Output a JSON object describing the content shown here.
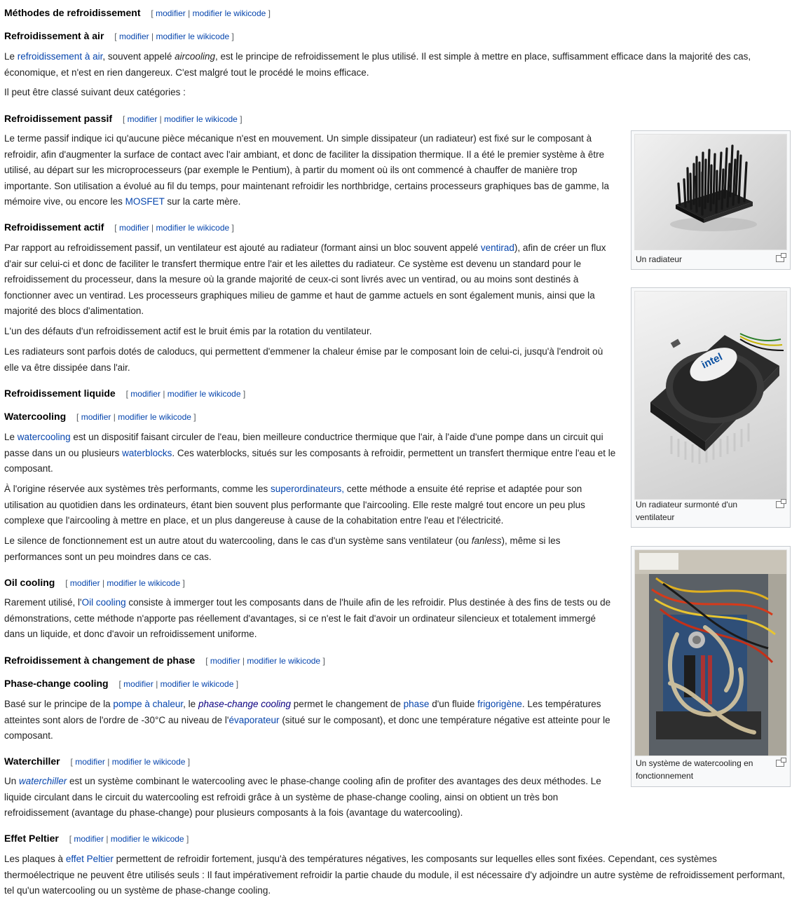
{
  "edit": {
    "modify": "modifier",
    "sep": "|",
    "modify_wikicode": "modifier le wikicode",
    "open": "[",
    "close": "]"
  },
  "sections": {
    "methodes": {
      "title": "Méthodes de refroidissement"
    },
    "air": {
      "title": "Refroidissement à air",
      "p1": {
        "a": "Le ",
        "link": "refroidissement à air",
        "b": ", souvent appelé ",
        "em": "aircooling",
        "c": ", est le principe de refroidissement le plus utilisé. Il est simple à mettre en place, suffisamment efficace dans la majorité des cas, économique, et n'est en rien dangereux. C'est malgré tout le procédé le moins efficace."
      },
      "p2": "Il peut être classé suivant deux catégories :"
    },
    "passif": {
      "title": "Refroidissement passif",
      "p1": {
        "a": "Le terme passif indique ici qu'aucune pièce mécanique n'est en mouvement. Un simple dissipateur (un radiateur) est fixé sur le composant à refroidir, afin d'augmenter la surface de contact avec l'air ambiant, et donc de faciliter la dissipation thermique. Il a été le premier système à être utilisé, au départ sur les microprocesseurs (par exemple le Pentium), à partir du moment où ils ont commencé à chauffer de manière trop importante. Son utilisation a évolué au fil du temps, pour maintenant refroidir les northbridge, certains processeurs graphiques bas de gamme, la mémoire vive, ou encore les ",
        "link": "MOSFET",
        "b": " sur la carte mère."
      }
    },
    "actif": {
      "title": "Refroidissement actif",
      "p1": {
        "a": "Par rapport au refroidissement passif, un ventilateur est ajouté au radiateur (formant ainsi un bloc souvent appelé ",
        "link": "ventirad",
        "b": "), afin de créer un flux d'air sur celui-ci et donc de faciliter le transfert thermique entre l'air et les ailettes du radiateur. Ce système est devenu un standard pour le refroidissement du processeur, dans la mesure où la grande majorité de ceux-ci sont livrés avec un ventirad, ou au moins sont destinés à fonctionner avec un ventirad. Les processeurs graphiques milieu de gamme et haut de gamme actuels en sont également munis, ainsi que la majorité des blocs d'alimentation."
      },
      "p2": "L'un des défauts d'un refroidissement actif est le bruit émis par la rotation du ventilateur.",
      "p3": "Les radiateurs sont parfois dotés de caloducs, qui permettent d'emmener la chaleur émise par le composant loin de celui-ci, jusqu'à l'endroit où elle va être dissipée dans l'air."
    },
    "liquide": {
      "title": "Refroidissement liquide"
    },
    "watercooling": {
      "title": "Watercooling",
      "p1": {
        "a": "Le ",
        "link1": "watercooling",
        "b": " est un dispositif faisant circuler de l'eau, bien meilleure conductrice thermique que l'air, à l'aide d'une pompe dans un circuit qui passe dans un ou plusieurs ",
        "link2": "waterblocks",
        "c": ". Ces waterblocks, situés sur les composants à refroidir, permettent un transfert thermique entre l'eau et le composant."
      },
      "p2": {
        "a": "À l'origine réservée aux systèmes très performants, comme les ",
        "link": "superordinateurs,",
        "b": " cette méthode a ensuite été reprise et adaptée pour son utilisation au quotidien dans les ordinateurs, étant bien souvent plus performante que l'aircooling. Elle reste malgré tout encore un peu plus complexe que l'aircooling à mettre en place, et un plus dangereuse à cause de la cohabitation entre l'eau et l'électricité."
      },
      "p3": {
        "a": "Le silence de fonctionnement est un autre atout du watercooling, dans le cas d'un système sans ventilateur (ou ",
        "em": "fanless",
        "b": "), même si les performances sont un peu moindres dans ce cas."
      }
    },
    "oil": {
      "title": "Oil cooling",
      "p1": {
        "a": "Rarement utilisé, l'",
        "link": "Oil cooling",
        "b": " consiste à immerger tout les composants dans de l'huile afin de les refroidir. Plus destinée à des fins de tests ou de démonstrations, cette méthode n'apporte pas réellement d'avantages, si ce n'est le fait d'avoir un ordinateur silencieux et totalement immergé dans un liquide, et donc d'avoir un refroidissement uniforme."
      }
    },
    "phase": {
      "title": "Refroidissement à changement de phase"
    },
    "phasechange": {
      "title": "Phase-change cooling",
      "p1": {
        "a": "Basé sur le principe de la ",
        "link1": "pompe à chaleur",
        "b": ", le ",
        "link2": "phase-change cooling",
        "c": " permet le changement de ",
        "link3": "phase",
        "d": " d'un fluide ",
        "link4": "frigorigène",
        "e": ". Les températures atteintes sont alors de l'ordre de -30°C au niveau de l'",
        "link5": "évaporateur",
        "f": " (situé sur le composant), et donc une température négative est atteinte pour le composant."
      }
    },
    "waterchiller": {
      "title": "Waterchiller",
      "p1": {
        "a": "Un ",
        "link": "waterchiller",
        "b": " est un système combinant le watercooling avec le phase-change cooling afin de profiter des avantages des deux méthodes. Le liquide circulant dans le circuit du watercooling est refroidi grâce à un système de phase-change cooling, ainsi on obtient un très bon refroidissement (avantage du phase-change) pour plusieurs composants à la fois (avantage du watercooling)."
      }
    },
    "peltier": {
      "title": "Effet Peltier",
      "p1": {
        "a": "Les plaques à ",
        "link": "effet Peltier",
        "b": " permettent de refroidir fortement, jusqu'à des températures négatives, les composants sur lequelles elles sont fixées. Cependant, ces systèmes thermoélectrique ne peuvent être utilisés seuls : Il faut impérativement refroidir la partie chaude du module, il est nécessaire d'y adjoindre un autre système de refroidissement performant, tel qu'un watercooling ou un système de phase-change cooling."
      }
    }
  },
  "figures": [
    {
      "caption": "Un radiateur"
    },
    {
      "caption": "Un radiateur surmonté d'un ventilateur"
    },
    {
      "caption": "Un système de watercooling en fonctionnement"
    }
  ],
  "colors": {
    "link": "#0645ad",
    "visited": "#0b0080",
    "red_link": "#ba0000",
    "text": "#222222"
  }
}
